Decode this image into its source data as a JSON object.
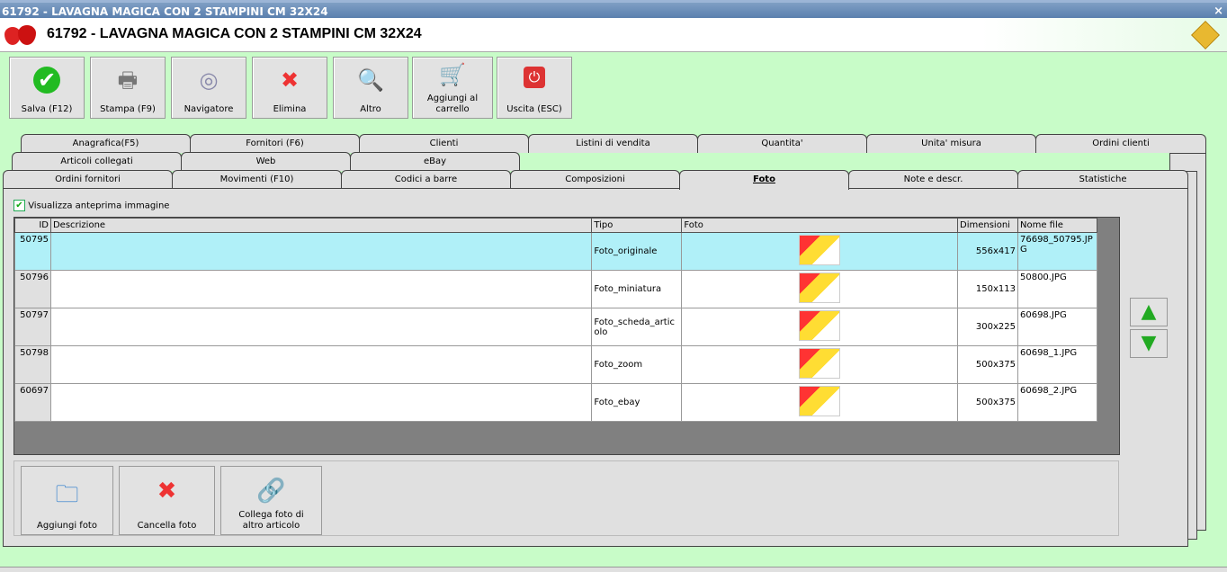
{
  "window": {
    "title": "61792 - LAVAGNA MAGICA CON 2 STAMPINI CM 32X24",
    "close": "×"
  },
  "header": {
    "title": "61792 - LAVAGNA MAGICA CON 2 STAMPINI CM 32X24"
  },
  "toolbar": [
    {
      "label": "Salva (F12)",
      "icon": "check-icon"
    },
    {
      "label": "Stampa (F9)",
      "icon": "printer-icon"
    },
    {
      "label": "Navigatore",
      "icon": "compass-icon"
    },
    {
      "label": "Elimina",
      "icon": "delete-x-icon"
    },
    {
      "label": "Altro",
      "icon": "book-search-icon"
    },
    {
      "label": "Aggiungi al carrello",
      "icon": "cart-icon"
    },
    {
      "label": "Uscita (ESC)",
      "icon": "power-icon"
    }
  ],
  "tabs": {
    "row1": [
      "Anagrafica(F5)",
      "Fornitori (F6)",
      "Clienti",
      "Listini di vendita",
      "Quantita'",
      "Unita' misura",
      "Ordini clienti"
    ],
    "row2": [
      "Articoli collegati",
      "Web",
      "eBay"
    ],
    "row3": [
      "Ordini fornitori",
      "Movimenti (F10)",
      "Codici a barre",
      "Composizioni",
      "Foto",
      "Note e descr.",
      "Statistiche"
    ],
    "active": "Foto"
  },
  "preview_checkbox": {
    "label": "Visualizza anteprima immagine",
    "checked": true
  },
  "grid": {
    "columns": [
      "ID",
      "Descrizione",
      "Tipo",
      "Foto",
      "Dimensioni",
      "Nome file"
    ],
    "rows": [
      {
        "id": "50795",
        "desc": "",
        "tipo": "Foto_originale",
        "dim": "556x417",
        "file": "76698_50795.JPG"
      },
      {
        "id": "50796",
        "desc": "",
        "tipo": "Foto_miniatura",
        "dim": "150x113",
        "file": "50800.JPG"
      },
      {
        "id": "50797",
        "desc": "",
        "tipo": "Foto_scheda_articolo",
        "dim": "300x225",
        "file": "60698.JPG"
      },
      {
        "id": "50798",
        "desc": "",
        "tipo": "Foto_zoom",
        "dim": "500x375",
        "file": "60698_1.JPG"
      },
      {
        "id": "60697",
        "desc": "",
        "tipo": "Foto_ebay",
        "dim": "500x375",
        "file": "60698_2.JPG"
      }
    ]
  },
  "bottom": [
    {
      "label": "Aggiungi foto",
      "icon": "add-photo-icon"
    },
    {
      "label": "Cancella foto",
      "icon": "delete-x-icon"
    },
    {
      "label": "Collega foto di altro articolo",
      "icon": "link-add-icon"
    }
  ],
  "arrows": {
    "up": "▲",
    "down": "▼"
  }
}
